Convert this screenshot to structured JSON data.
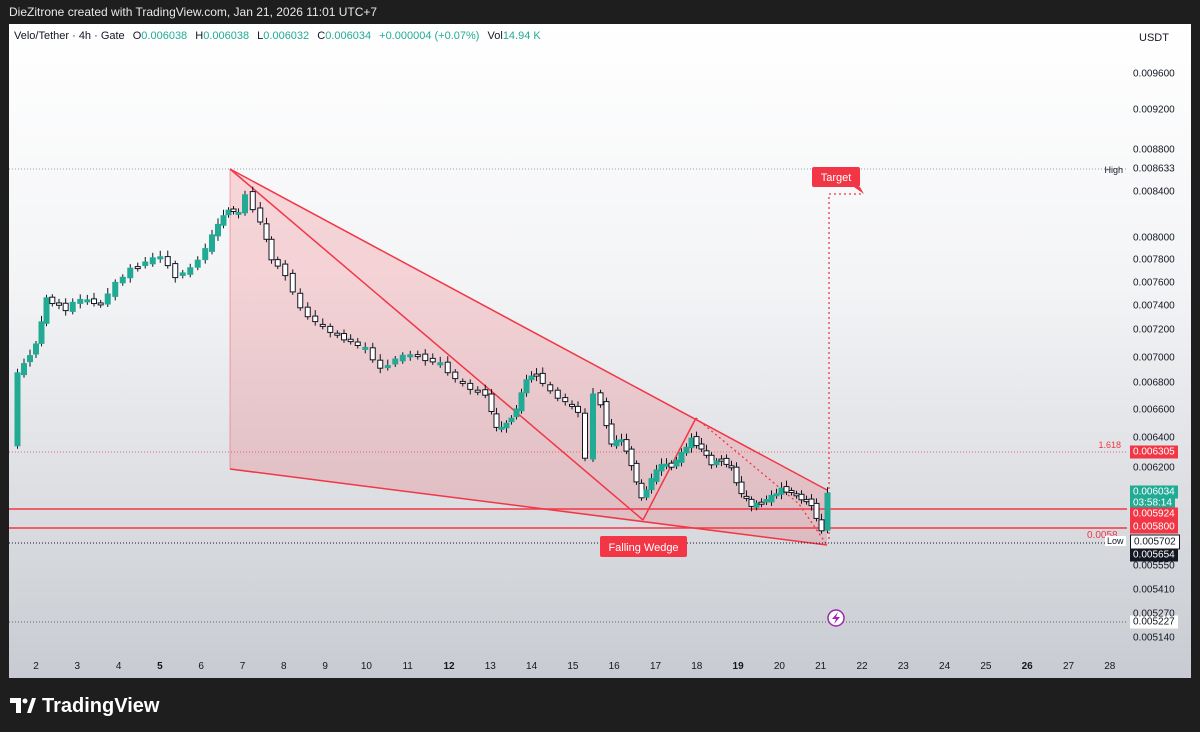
{
  "header": {
    "attribution": "DieZitrone created with TradingView.com, Jan 21, 2026 11:01 UTC+7"
  },
  "legend": {
    "symbol": "Velo/Tether · 4h · Gate",
    "open_label": "O",
    "open": "0.006038",
    "high_label": "H",
    "high": "0.006038",
    "low_label": "L",
    "low": "0.006032",
    "close_label": "C",
    "close": "0.006034",
    "change": "+0.000004 (+0.07%)",
    "vol_label": "Vol",
    "vol": "14.94 K"
  },
  "price_axis": {
    "unit": "USDT",
    "ticks": [
      "0.009600",
      "0.009200",
      "0.008800",
      "0.008400",
      "0.008000",
      "0.007800",
      "0.007600",
      "0.007400",
      "0.007200",
      "0.007000",
      "0.006800",
      "0.006600",
      "0.006400",
      "0.006200",
      "0.005550",
      "0.005410",
      "0.005270",
      "0.005140"
    ],
    "high_label": "High",
    "high_value": "0.008633",
    "fib_label": "1.618",
    "fib_value": "0.006305",
    "last_price": "0.006034",
    "countdown": "03:58:14",
    "level_upper": "0.005924",
    "level_lower": "0.005800",
    "level_text": "0.0058",
    "low_label": "Low",
    "low_value": "0.005702",
    "dark_tag_1": "0.005654",
    "dark_tag_2": "0.005227"
  },
  "time_axis": {
    "labels": [
      "2",
      "3",
      "4",
      "5",
      "6",
      "7",
      "8",
      "9",
      "10",
      "11",
      "12",
      "13",
      "14",
      "15",
      "16",
      "17",
      "18",
      "19",
      "20",
      "21",
      "22",
      "23",
      "24",
      "25",
      "26",
      "27",
      "28"
    ],
    "bold": [
      "5",
      "12",
      "19",
      "26"
    ]
  },
  "annotations": {
    "target": "Target",
    "pattern": "Falling Wedge"
  },
  "colors": {
    "up": "#22ab94",
    "down": "#131722",
    "accent": "#f23645",
    "wedge_fill": "#f23645"
  },
  "icons": {
    "flash": "lightning-icon",
    "logo": "tradingview-logo-icon"
  },
  "footer": {
    "brand": "TradingView"
  }
}
